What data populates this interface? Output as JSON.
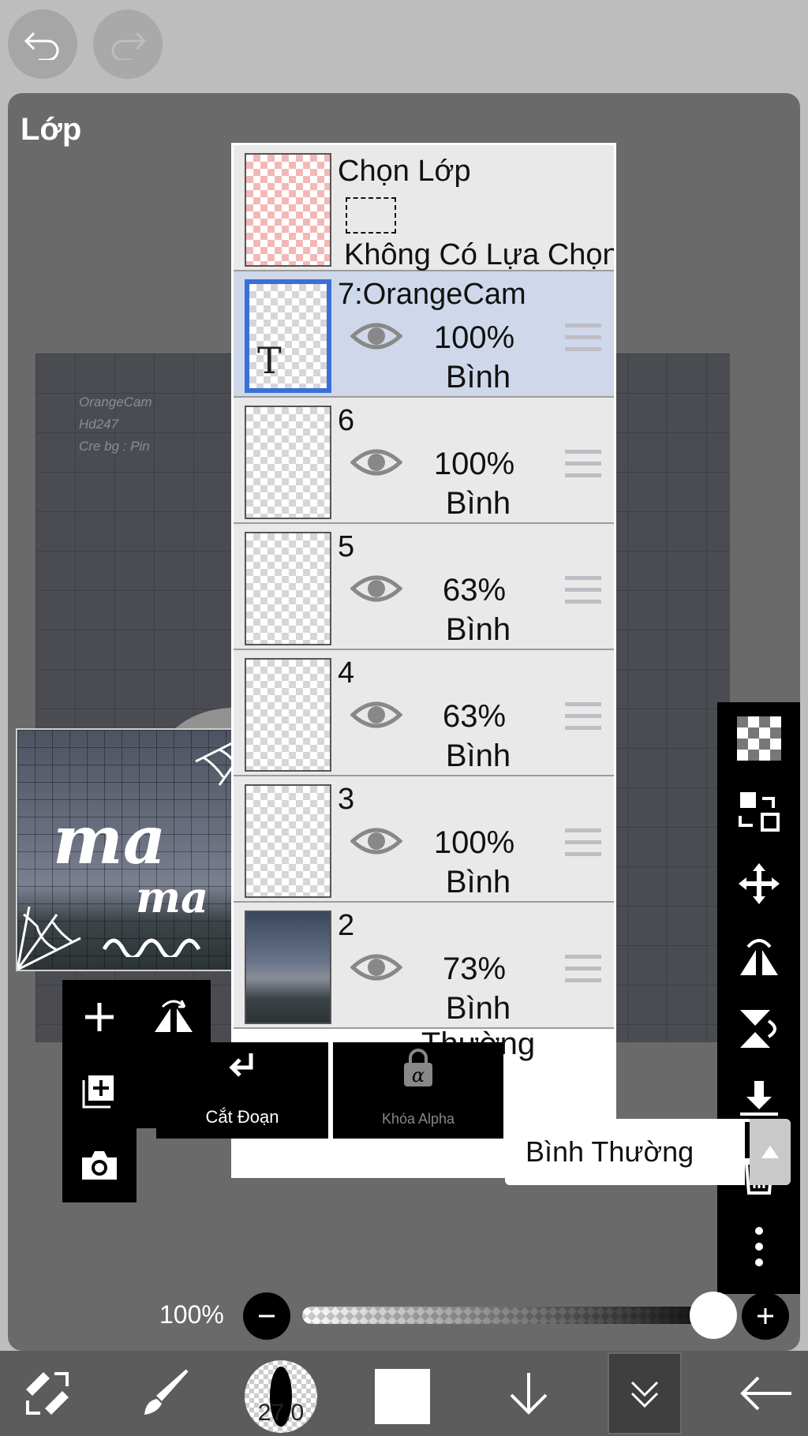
{
  "panel": {
    "title": "Lớp"
  },
  "canvas": {
    "lines": [
      "OrangeCam",
      "Hd247",
      "Cre bg : Pin"
    ]
  },
  "thumbnail": {
    "words": [
      "ma",
      "ma"
    ]
  },
  "selection_layer": {
    "title": "Chọn Lớp",
    "status": "Không Có Lựa Chọn"
  },
  "layers": [
    {
      "name": "7:OrangeCam",
      "opacity": "100%",
      "blend": "Bình Thường",
      "selected": true,
      "type_glyph": "T"
    },
    {
      "name": "6",
      "opacity": "100%",
      "blend": "Bình Thường"
    },
    {
      "name": "5",
      "opacity": "63%",
      "blend": "Bình Thường"
    },
    {
      "name": "4",
      "opacity": "63%",
      "blend": "Bình Thường"
    },
    {
      "name": "3",
      "opacity": "100%",
      "blend": "Bình Thường"
    },
    {
      "name": "2",
      "opacity": "73%",
      "blend": "Bình Thường"
    }
  ],
  "controls": {
    "clip_label": "Cắt Đoạn",
    "alpha_lock_label": "Khóa Alpha",
    "alpha_glyph": "α",
    "blend_mode": "Bình Thường",
    "opacity_label": "100%",
    "opacity_value": 1.0
  },
  "bottombar": {
    "brush_size": "27.0"
  },
  "icons": {
    "top": [
      "undo-icon",
      "redo-icon"
    ],
    "left_tools": [
      "add-layer-icon",
      "flip-horizontal-icon",
      "add-copy-layer-icon",
      "flip-vertical-icon",
      "camera-icon"
    ],
    "right_tools": [
      "transparency-icon",
      "swap-layer-icon",
      "move-icon",
      "flip-icon",
      "flip-vertical-icon",
      "merge-down-icon",
      "trash-icon",
      "more-icon"
    ],
    "bottom": [
      "transform-icon",
      "brush-icon",
      "brush-size",
      "color-swatch",
      "download-arrow-icon",
      "layers-icon",
      "back-arrow-icon"
    ]
  },
  "colors": {
    "selected_layer": "#cfd8ea",
    "selected_border": "#3a6fd6",
    "panel": "#6a6a6a"
  }
}
